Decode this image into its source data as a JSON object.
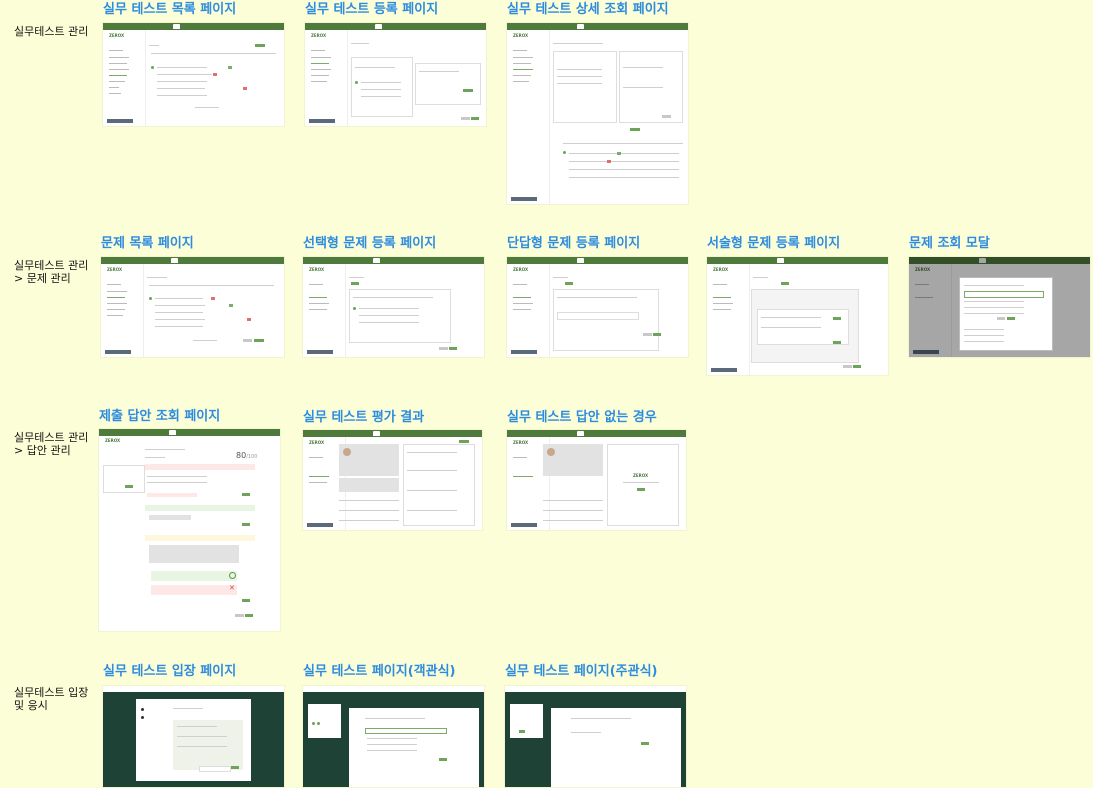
{
  "sections": [
    {
      "label": "실무테스트 관리"
    },
    {
      "label": "실무테스트 관리\n> 문제 관리"
    },
    {
      "label": "실무테스트 관리\n> 답안 관리"
    },
    {
      "label": "실무테스트 입장\n및 응시"
    }
  ],
  "frames": [
    {
      "title": "실무 테스트 목록 페이지"
    },
    {
      "title": "실무 테스트 등록 페이지"
    },
    {
      "title": "실무 테스트 상세 조회 페이지"
    },
    {
      "title": "문제 목록 페이지"
    },
    {
      "title": "선택형 문제 등록 페이지"
    },
    {
      "title": "단답형 문제 등록 페이지"
    },
    {
      "title": "서술형 문제 등록 페이지"
    },
    {
      "title": "문제 조회 모달"
    },
    {
      "title": "제출 답안 조회 페이지"
    },
    {
      "title": "실무 테스트 평가 결과"
    },
    {
      "title": "실무 테스트 답안 없는 경우"
    },
    {
      "title": "실무 테스트 입장 페이지"
    },
    {
      "title": "실무 테스트 페이지(객관식)"
    },
    {
      "title": "실무 테스트 페이지(주관식)"
    }
  ],
  "score": "80",
  "score_total": "/100",
  "colors": {
    "background": "#fbfed6",
    "title": "#2d8be0",
    "brand_green": "#4e7a3c",
    "dark_bg": "#1f4236"
  }
}
